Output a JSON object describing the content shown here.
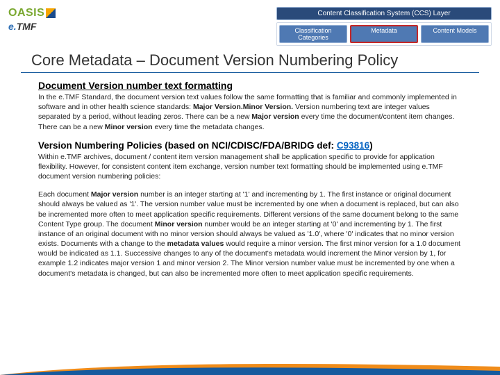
{
  "header": {
    "oasis_a": "OASIS",
    "oasis_b": "",
    "etmf_e": "e.",
    "etmf_tmf": "TMF"
  },
  "ccs": {
    "layer": "Content Classification System (CCS) Layer",
    "boxes": [
      "Classification Categories",
      "Metadata",
      "Content Models"
    ]
  },
  "title": "Core Metadata – Document Version Numbering Policy",
  "section1": {
    "heading": "Document Version number text formatting",
    "body_a": "In the e.TMF Standard, the document version text values follow the same formatting that is familiar and commonly implemented in software and in other health science standards: ",
    "body_b": "Major Version.Minor Version.",
    "body_c": " Version numbering text are integer values separated by a period, without leading zeros. There can be a new ",
    "body_d": "Major version",
    "body_e": " every time the document/content item changes. There can be a new ",
    "body_f": "Minor version",
    "body_g": " every time the metadata changes."
  },
  "section2": {
    "heading_a": "Version Numbering Policies  (based on NCI/CDISC/FDA/BRIDG def: ",
    "heading_link": "C93816",
    "heading_b": ")",
    "body": "Within e.TMF archives,  document / content item version management shall be application specific to provide for application flexibility.  However, for consistent content item exchange, version number text formatting should be implemented using e.TMF document version numbering policies:"
  },
  "section3": {
    "a": "Each document ",
    "b": "Major version",
    "c": " number is an integer starting at '1' and incrementing by 1.  The first instance or original document should always be valued as '1'. The version number value must be incremented by one when a document is replaced, but can also be incremented more often to meet application specific requirements.  Different versions of the same document belong to the same Content Type group.   The document ",
    "d": "Minor version",
    "e": " number would be an integer starting at '0' and incrementing by 1.  The first instance of an original document with no minor version should always be valued as '1.0', where '0' indicates that no minor version exists.  Documents with a change to the ",
    "f": "metadata values",
    "g": " would require a minor version. The first minor version for a 1.0 document would be indicated as 1.1.  Successive changes to any of the document's metadata would increment the Minor version by 1, for example 1.2 indicates major version 1 and minor version 2.  The Minor version number value must be incremented by one when a document's metadata is changed, but can also be incremented more often to meet application specific requirements."
  }
}
